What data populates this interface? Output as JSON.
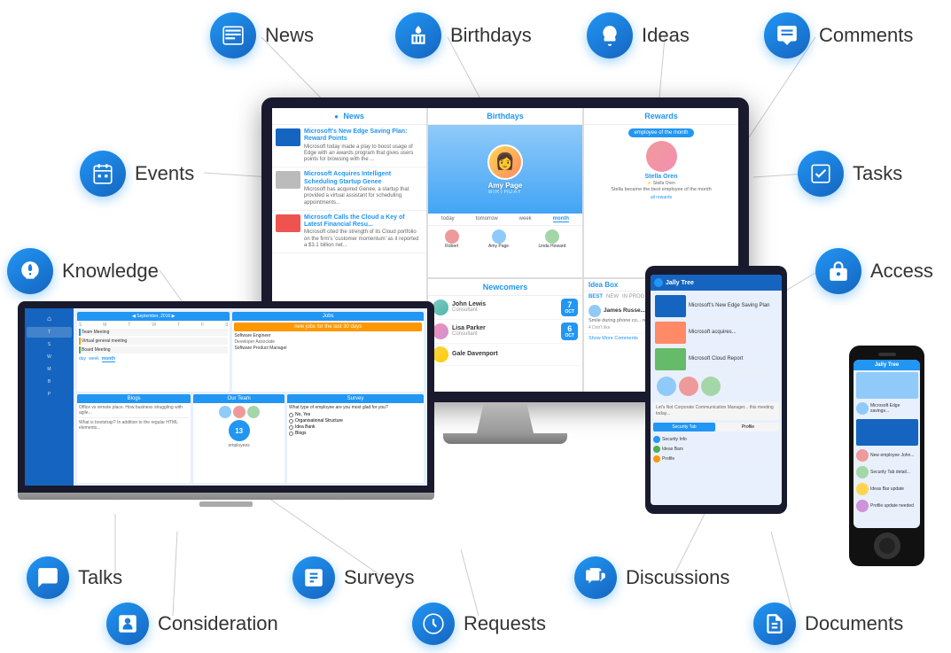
{
  "features": {
    "news": {
      "label": "News",
      "icon": "news"
    },
    "birthdays": {
      "label": "Birthdays",
      "icon": "birthdays"
    },
    "ideas": {
      "label": "Ideas",
      "icon": "ideas"
    },
    "comments": {
      "label": "Comments",
      "icon": "comments"
    },
    "events": {
      "label": "Events",
      "icon": "events"
    },
    "tasks": {
      "label": "Tasks",
      "icon": "tasks"
    },
    "knowledge": {
      "label": "Knowledge",
      "icon": "knowledge"
    },
    "access": {
      "label": "Access",
      "icon": "access"
    },
    "talks": {
      "label": "Talks",
      "icon": "talks"
    },
    "surveys": {
      "label": "Surveys",
      "icon": "surveys"
    },
    "discussions": {
      "label": "Discussions",
      "icon": "discussions"
    },
    "consideration": {
      "label": "Consideration",
      "icon": "consideration"
    },
    "requests": {
      "label": "Requests",
      "icon": "requests"
    },
    "documents": {
      "label": "Documents",
      "icon": "documents"
    }
  },
  "screen": {
    "news_title": "News",
    "birthdays_title": "Birthdays",
    "rewards_title": "Rewards",
    "newcomers_title": "Newcomers",
    "ideabox_title": "Idea Box",
    "news_items": [
      {
        "title": "Microsoft's New Edge Saving Plan: Reward Points",
        "body": "Microsoft today made a play to boost usage of Edge with an awards program that gives users points for browsing with the ..."
      },
      {
        "title": "Microsoft Acquires Intelligent Scheduling Startup Genee",
        "body": "Microsoft has acquired Genee, a startup that provided a virtual assistant for scheduling appointments..."
      },
      {
        "title": "Microsoft Calls the Cloud a Key of Latest Financial Resu...",
        "body": "Microsoft cited the strength of its Cloud portfolio on the firm's 'customer momentum' as it reported a $3.1 billion net..."
      }
    ],
    "birthday_person": "Amy Page",
    "birthday_subtitle": "BIRTHDAY",
    "birthday_tabs": [
      "today",
      "tomorrow",
      "week",
      "month"
    ],
    "rewards_badge": "employee of the month",
    "rewards_person": "Stella Oren",
    "rewards_desc": "Stella became the best employee of the month",
    "newcomers": [
      {
        "name": "John Lewis",
        "role": "Consultant",
        "day": "7"
      },
      {
        "name": "Lisa Parker",
        "role": "Consultant",
        "day": "6"
      },
      {
        "name": "Gale Davenport",
        "role": "",
        "day": ""
      }
    ],
    "idea_tabs": [
      "BEST",
      "NEW",
      "IN PROG..."
    ],
    "idea_author": "James Russe...",
    "idea_text": "Smile during phone co... requirement to the Sa... feel it!",
    "idea_likes": "4 Don't like",
    "show_more": "Show More Comments"
  }
}
